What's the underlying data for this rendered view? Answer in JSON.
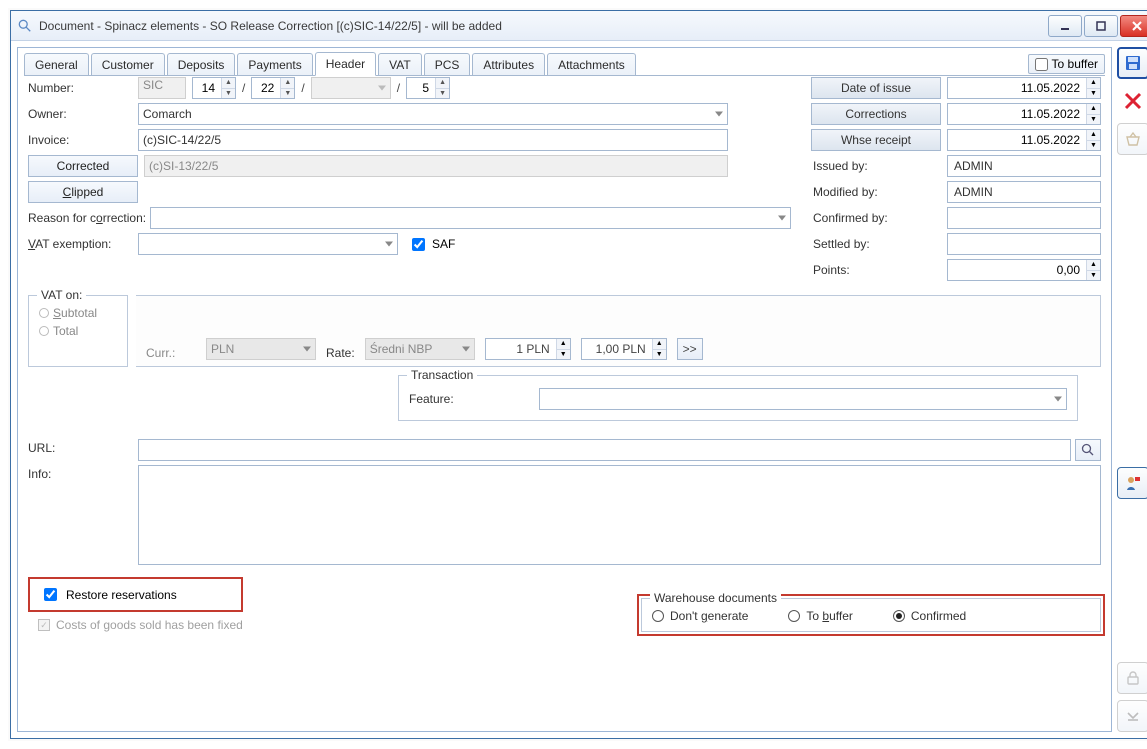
{
  "window": {
    "title": "Document - Spinacz elements - SO Release Correction [(c)SIC-14/22/5]  - will be added"
  },
  "tabs": {
    "general": "General",
    "customer": "Customer",
    "deposits": "Deposits",
    "payments": "Payments",
    "header": "Header",
    "vat": "VAT",
    "pcs": "PCS",
    "attributes": "Attributes",
    "attachments": "Attachments"
  },
  "tobuffer": {
    "label": "To buffer",
    "checked": false
  },
  "number": {
    "label": "Number:",
    "series": "SIC",
    "p1": "14",
    "p2": "22",
    "p3": "",
    "p4": "5"
  },
  "owner": {
    "label": "Owner:",
    "value": "Comarch"
  },
  "invoice": {
    "label": "Invoice:",
    "value": "(c)SIC-14/22/5"
  },
  "corrected": {
    "btn": "Corrected",
    "value": "(c)SI-13/22/5"
  },
  "clipped": {
    "btn": "Clipped"
  },
  "reason": {
    "label": "Reason for correction:"
  },
  "vatex": {
    "label": "VAT exemption:",
    "saf": "SAF"
  },
  "dates": {
    "issue_btn": "Date of issue",
    "issue": "11.05.2022",
    "corr_btn": "Corrections",
    "corr": "11.05.2022",
    "whse_btn": "Whse receipt",
    "whse": "11.05.2022"
  },
  "right": {
    "issuedby_lbl": "Issued by:",
    "issuedby": "ADMIN",
    "modby_lbl": "Modified by:",
    "modby": "ADMIN",
    "confby_lbl": "Confirmed by:",
    "confby": "",
    "settby_lbl": "Settled by:",
    "settby": "",
    "points_lbl": "Points:",
    "points": "0,00"
  },
  "vatgroup": {
    "legend": "VAT on:",
    "subtotal": "Subtotal",
    "total": "Total"
  },
  "curr": {
    "lbl": "Curr.:",
    "code": "PLN",
    "rate_lbl": "Rate:",
    "rate_name": "Średni NBP",
    "v1": "1 PLN",
    "v2": "1,00 PLN",
    "go": ">>"
  },
  "tx": {
    "legend": "Transaction",
    "feature_lbl": "Feature:"
  },
  "url": {
    "label": "URL:"
  },
  "info": {
    "label": "Info:"
  },
  "bottom": {
    "restore": "Restore reservations",
    "cogs": "Costs of goods sold has been fixed"
  },
  "wh": {
    "legend": "Warehouse documents",
    "dont": "Don't generate",
    "tobuf": "To buffer",
    "conf": "Confirmed"
  }
}
